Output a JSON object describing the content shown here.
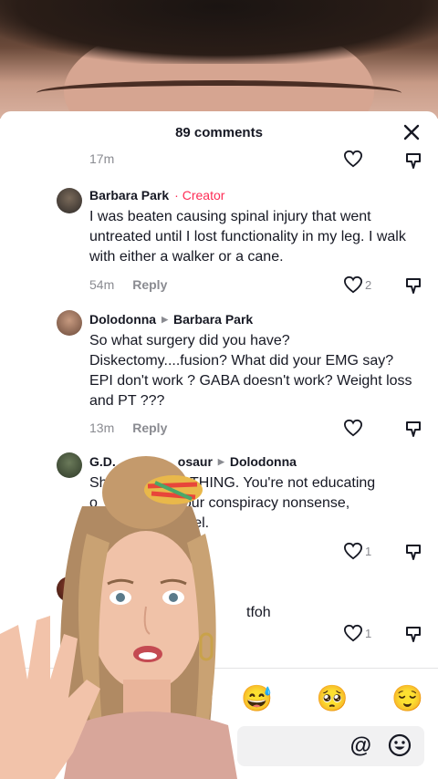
{
  "header": {
    "title": "89 comments"
  },
  "top_row": {
    "time": "17m"
  },
  "comments": [
    {
      "author": "Barbara Park",
      "badge": "Creator",
      "text": "I was beaten causing spinal injury that went untreated until I lost functionality in my leg. I walk with either a walker or a cane.",
      "time": "54m",
      "reply": "Reply",
      "likes": "2"
    },
    {
      "author": "Dolodonna",
      "reply_to": "Barbara Park",
      "text": "So what surgery did you have? Diskectomy....fusion? What did your EMG say? EPI don't work ? GABA doesn't work? Weight loss and PT ???",
      "time": "13m",
      "reply": "Reply"
    },
    {
      "author": "G.D.",
      "author_tail": "osaur",
      "reply_to": "Dolodonna",
      "text_a": "Sh",
      "text_b": "OTHING. You're not educating",
      "text_c": "o",
      "text_d": "your conspiracy nonsense,",
      "text_e": "y",
      "text_f": "ruel.",
      "likes": "1"
    },
    {
      "text_visible": "tfoh",
      "likes": "1"
    }
  ],
  "emoji_bar": [
    "😅",
    "🥺",
    "😌"
  ],
  "input_icons": {
    "mention": "@",
    "emoji": "smile-icon"
  }
}
